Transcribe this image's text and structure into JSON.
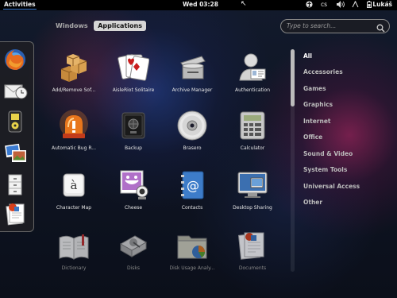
{
  "topbar": {
    "activities": "Activities",
    "clock": "Wed 03:28",
    "keyboard_layout": "cs",
    "user": "Lukáš"
  },
  "view_selector": {
    "windows": "Windows",
    "applications": "Applications"
  },
  "search": {
    "placeholder": "Type to search..."
  },
  "dash": {
    "items": [
      "firefox-icon",
      "mail-clock-icon",
      "music-player-icon",
      "photo-viewer-icon",
      "file-cabinet-icon",
      "office-document-icon"
    ]
  },
  "apps": [
    {
      "label": "Add/Remove Sof...",
      "icon": "packages-icon"
    },
    {
      "label": "AisleRiot Solitaire",
      "icon": "playing-cards-icon"
    },
    {
      "label": "Archive Manager",
      "icon": "archive-icon"
    },
    {
      "label": "Authentication",
      "icon": "person-id-icon"
    },
    {
      "label": "Automatic Bug R...",
      "icon": "alarm-light-icon"
    },
    {
      "label": "Backup",
      "icon": "safe-icon"
    },
    {
      "label": "Brasero",
      "icon": "disc-icon"
    },
    {
      "label": "Calculator",
      "icon": "calculator-icon"
    },
    {
      "label": "Character Map",
      "icon": "character-key-icon"
    },
    {
      "label": "Cheese",
      "icon": "webcam-photo-icon"
    },
    {
      "label": "Contacts",
      "icon": "address-book-icon"
    },
    {
      "label": "Desktop Sharing",
      "icon": "monitors-icon"
    },
    {
      "label": "Dictionary",
      "icon": "book-icon"
    },
    {
      "label": "Disks",
      "icon": "disk-drive-icon"
    },
    {
      "label": "Disk Usage Analy...",
      "icon": "folder-pie-icon"
    },
    {
      "label": "Documents",
      "icon": "documents-icon"
    }
  ],
  "categories": [
    "All",
    "Accessories",
    "Games",
    "Graphics",
    "Internet",
    "Office",
    "Sound & Video",
    "System Tools",
    "Universal Access",
    "Other"
  ],
  "selected_category": "All"
}
